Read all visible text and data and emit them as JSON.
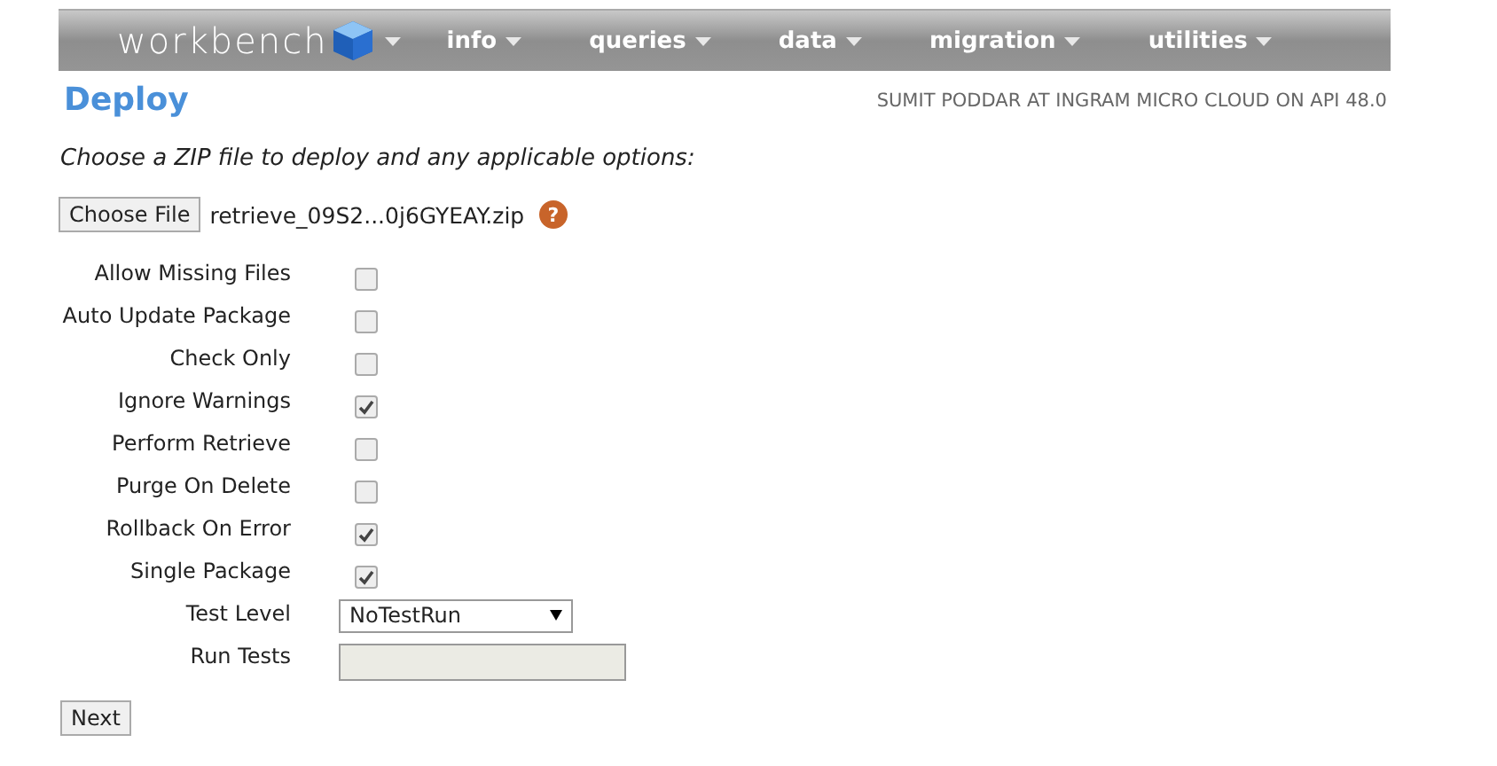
{
  "nav": {
    "logo": "workbench",
    "menus": [
      {
        "label": "info"
      },
      {
        "label": "queries"
      },
      {
        "label": "data"
      },
      {
        "label": "migration"
      },
      {
        "label": "utilities"
      }
    ]
  },
  "page": {
    "title": "Deploy",
    "user_info": "SUMIT PODDAR AT INGRAM MICRO CLOUD ON API 48.0"
  },
  "instructions": "Choose a ZIP file to deploy and any applicable options:",
  "file": {
    "button": "Choose File",
    "filename": "retrieve_09S2...0j6GYEAY.zip",
    "help": "?"
  },
  "options": [
    {
      "kind": "checkbox",
      "label": "Allow Missing Files",
      "checked": false
    },
    {
      "kind": "checkbox",
      "label": "Auto Update Package",
      "checked": false
    },
    {
      "kind": "checkbox",
      "label": "Check Only",
      "checked": false
    },
    {
      "kind": "checkbox",
      "label": "Ignore Warnings",
      "checked": true
    },
    {
      "kind": "checkbox",
      "label": "Perform Retrieve",
      "checked": false
    },
    {
      "kind": "checkbox",
      "label": "Purge On Delete",
      "checked": false
    },
    {
      "kind": "checkbox",
      "label": "Rollback On Error",
      "checked": true
    },
    {
      "kind": "checkbox",
      "label": "Single Package",
      "checked": true
    },
    {
      "kind": "select",
      "label": "Test Level",
      "value": "NoTestRun"
    },
    {
      "kind": "field",
      "label": "Run Tests",
      "disabled": true
    }
  ],
  "next_button": "Next"
}
